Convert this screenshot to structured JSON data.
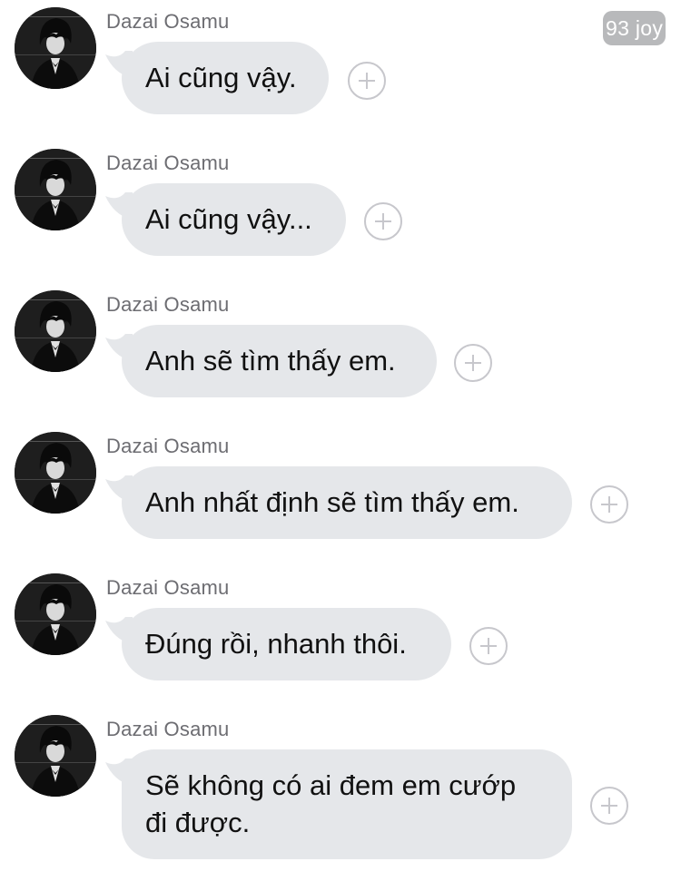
{
  "badge": {
    "text": "93 joy"
  },
  "messages": [
    {
      "sender": "Dazai Osamu",
      "text": "Ai cũng vậy."
    },
    {
      "sender": "Dazai Osamu",
      "text": "Ai cũng vậy..."
    },
    {
      "sender": "Dazai Osamu",
      "text": "Anh sẽ tìm thấy em."
    },
    {
      "sender": "Dazai Osamu",
      "text": "Anh nhất định sẽ tìm thấy em."
    },
    {
      "sender": "Dazai Osamu",
      "text": "Đúng rồi, nhanh thôi."
    },
    {
      "sender": "Dazai Osamu",
      "text_line1": "Sẽ không có ai đem em cướp",
      "text_line2": "đi được."
    }
  ],
  "icons": {
    "avatar": "avatar-icon",
    "add_reaction": "plus-circle-icon"
  },
  "colors": {
    "bubble": "#e5e7ea",
    "sender_text": "#6d6d72",
    "badge_bg": "#b8b9bb"
  }
}
